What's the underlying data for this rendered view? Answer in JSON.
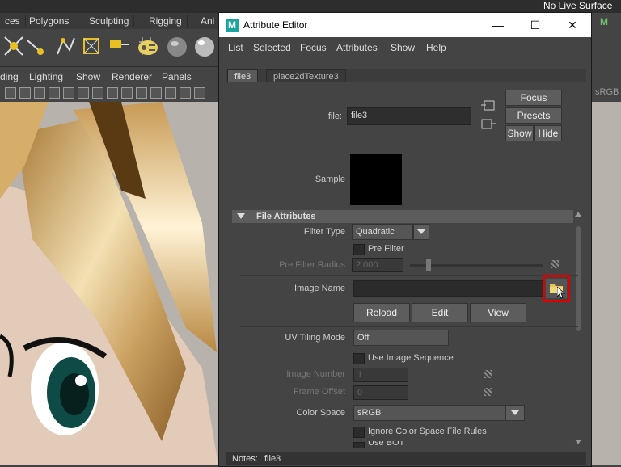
{
  "maya": {
    "top_right_text": "No Live Surface",
    "shelf_tabs": [
      "ces",
      "Polygons",
      "Sculpting",
      "Rigging",
      "Ani"
    ],
    "panel_menu": [
      "ding",
      "Lighting",
      "Show",
      "Renderer",
      "Panels"
    ],
    "viewport_label": "sRGB"
  },
  "ae": {
    "window_title": "Attribute Editor",
    "win_minimize": "—",
    "win_maximize": "☐",
    "win_close": "✕",
    "menu": [
      "List",
      "Selected",
      "Focus",
      "Attributes",
      "Show",
      "Help"
    ],
    "tabs": [
      "file3",
      "place2dTexture3"
    ],
    "file_label": "file:",
    "file_value": "file3",
    "focus_btn": "Focus",
    "presets_btn": "Presets",
    "show_btn": "Show",
    "hide_btn": "Hide",
    "sample_label": "Sample",
    "section_title": "File Attributes",
    "filter_type_label": "Filter Type",
    "filter_type_value": "Quadratic",
    "pre_filter_label": "Pre Filter",
    "pre_filter_radius_label": "Pre Filter Radius",
    "pre_filter_radius_value": "2.000",
    "image_name_label": "Image Name",
    "image_name_value": "",
    "reload_btn": "Reload",
    "edit_btn": "Edit",
    "view_btn": "View",
    "uv_tiling_label": "UV Tiling Mode",
    "uv_tiling_value": "Off",
    "use_image_seq_label": "Use Image Sequence",
    "image_number_label": "Image Number",
    "image_number_value": "1",
    "frame_offset_label": "Frame Offset",
    "frame_offset_value": "0",
    "color_space_label": "Color Space",
    "color_space_value": "sRGB",
    "ignore_cs_label": "Ignore Color Space File Rules",
    "use_bot_label": "Use BOT",
    "notes_label": "Notes:",
    "notes_value": "file3"
  }
}
